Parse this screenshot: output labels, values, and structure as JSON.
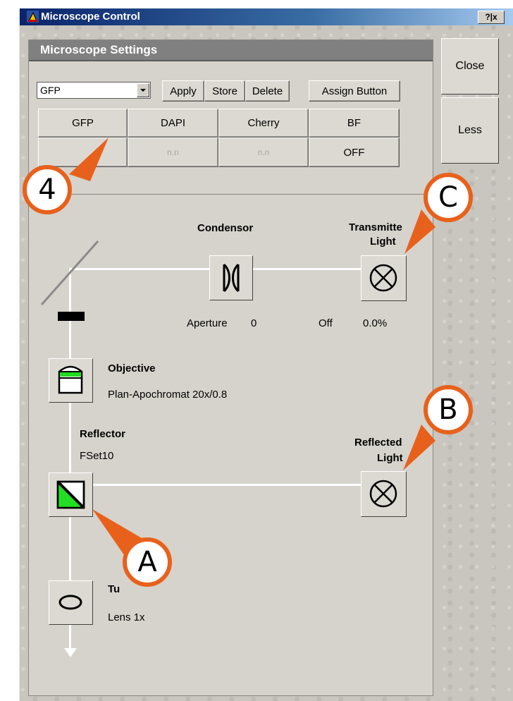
{
  "window": {
    "title": "Microscope Control",
    "help_label": "?|x"
  },
  "settings": {
    "header": "Microscope Settings",
    "preset_value": "GFP",
    "apply_label": "Apply",
    "store_label": "Store",
    "delete_label": "Delete",
    "assign_label": "Assign Button",
    "presets_row1": [
      "GFP",
      "DAPI",
      "Cherry",
      "BF"
    ],
    "presets_row2": [
      "",
      "n.n",
      "n.n",
      "OFF"
    ]
  },
  "side_buttons": {
    "close": "Close",
    "less": "Less"
  },
  "lightpath": {
    "condensor_label": "Condensor",
    "aperture_label": "Aperture",
    "aperture_value": "0",
    "transmitted_label_1": "Transmitte",
    "transmitted_label_2": "Light",
    "transmitted_state": "Off",
    "transmitted_value": "0.0%",
    "objective_label": "Objective",
    "objective_value": "Plan-Apochromat 20x/0.8",
    "reflector_label": "Reflector",
    "reflector_value": "FSet10",
    "reflected_label_1": "Reflected",
    "reflected_label_2": "Light",
    "tubelens_label": "Tu",
    "tubelens_value": "Lens 1x"
  },
  "callouts": [
    "4",
    "C",
    "B",
    "A"
  ],
  "colors": {
    "accent_callout": "#e8611c",
    "filter_green": "#22dd22",
    "titlebar": "#0a246a"
  }
}
